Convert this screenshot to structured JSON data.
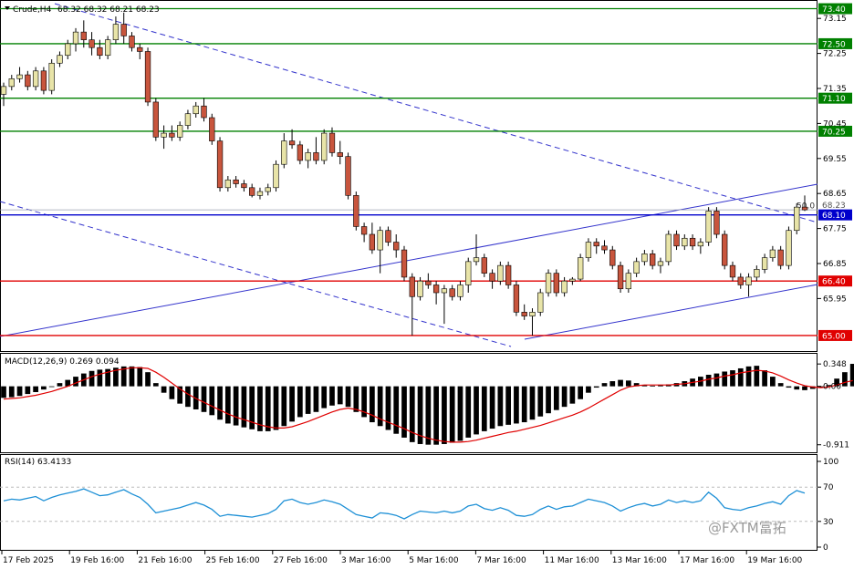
{
  "window": {
    "symbol_label": "Crude,H4",
    "ohlc_label": "68.32 68.32 68.21 68.23",
    "watermark": "@FXTM富拓"
  },
  "colors": {
    "bull": "#e8e4a8",
    "bear": "#c8553d",
    "wick": "#000000",
    "support": "#e00000",
    "resistance": "#008000",
    "pivot": "#0000cc",
    "macd_signal": "#e00000",
    "rsi_line": "#1e90d6"
  },
  "chart_data": [
    {
      "type": "candlestick",
      "name": "price",
      "ylim": [
        64.6,
        73.6
      ],
      "y_ticks": [
        "73.15",
        "72.25",
        "71.35",
        "70.45",
        "69.55",
        "68.65",
        "67.75",
        "66.85",
        "65.95"
      ],
      "x_tick_labels": [
        "17 Feb 2025",
        "19 Feb 16:00",
        "21 Feb 16:00",
        "25 Feb 16:00",
        "27 Feb 16:00",
        "3 Mar 16:00",
        "5 Mar 16:00",
        "7 Mar 16:00",
        "11 Mar 16:00",
        "13 Mar 16:00",
        "17 Mar 16:00",
        "19 Mar 16:00"
      ],
      "horizontal_levels": [
        {
          "label": "73.40",
          "value": 73.4,
          "kind": "resistance"
        },
        {
          "label": "72.50",
          "value": 72.5,
          "kind": "resistance"
        },
        {
          "label": "71.10",
          "value": 71.1,
          "kind": "resistance"
        },
        {
          "label": "70.25",
          "value": 70.25,
          "kind": "resistance"
        },
        {
          "label": "68.10",
          "value": 68.1,
          "kind": "pivot"
        },
        {
          "label": "66.40",
          "value": 66.4,
          "kind": "support"
        },
        {
          "label": "65.00",
          "value": 65.0,
          "kind": "support"
        }
      ],
      "current_price": {
        "label": "68.23",
        "value": 68.23
      },
      "fib_label": "50.0",
      "fib_value": 68.25,
      "candles": [
        [
          71.2,
          71.5,
          70.9,
          71.4
        ],
        [
          71.4,
          71.7,
          71.3,
          71.6
        ],
        [
          71.6,
          71.9,
          71.5,
          71.7
        ],
        [
          71.7,
          71.8,
          71.3,
          71.4
        ],
        [
          71.4,
          71.9,
          71.3,
          71.8
        ],
        [
          71.8,
          71.9,
          71.2,
          71.3
        ],
        [
          71.3,
          72.1,
          71.2,
          72.0
        ],
        [
          72.0,
          72.3,
          71.9,
          72.2
        ],
        [
          72.2,
          72.6,
          72.1,
          72.5
        ],
        [
          72.5,
          72.9,
          72.3,
          72.8
        ],
        [
          72.8,
          73.1,
          72.4,
          72.6
        ],
        [
          72.6,
          72.8,
          72.2,
          72.4
        ],
        [
          72.4,
          72.6,
          72.1,
          72.2
        ],
        [
          72.2,
          72.7,
          72.1,
          72.6
        ],
        [
          72.6,
          73.2,
          72.5,
          73.0
        ],
        [
          73.0,
          73.3,
          72.5,
          72.7
        ],
        [
          72.7,
          72.8,
          72.3,
          72.4
        ],
        [
          72.4,
          72.5,
          72.1,
          72.3
        ],
        [
          72.3,
          72.4,
          70.9,
          71.0
        ],
        [
          71.0,
          71.1,
          70.0,
          70.1
        ],
        [
          70.1,
          70.4,
          69.8,
          70.2
        ],
        [
          70.2,
          70.4,
          70.0,
          70.1
        ],
        [
          70.1,
          70.5,
          70.0,
          70.4
        ],
        [
          70.4,
          70.8,
          70.3,
          70.7
        ],
        [
          70.7,
          71.0,
          70.6,
          70.9
        ],
        [
          70.9,
          71.1,
          70.5,
          70.6
        ],
        [
          70.6,
          70.7,
          69.9,
          70.0
        ],
        [
          70.0,
          70.1,
          68.7,
          68.8
        ],
        [
          68.8,
          69.1,
          68.7,
          69.0
        ],
        [
          69.0,
          69.1,
          68.8,
          68.9
        ],
        [
          68.9,
          69.0,
          68.7,
          68.8
        ],
        [
          68.8,
          68.9,
          68.55,
          68.6
        ],
        [
          68.6,
          68.8,
          68.5,
          68.7
        ],
        [
          68.7,
          68.9,
          68.6,
          68.8
        ],
        [
          68.8,
          69.5,
          68.7,
          69.4
        ],
        [
          69.4,
          70.2,
          69.3,
          70.0
        ],
        [
          70.0,
          70.3,
          69.8,
          69.9
        ],
        [
          69.9,
          70.0,
          69.4,
          69.5
        ],
        [
          69.5,
          69.8,
          69.3,
          69.7
        ],
        [
          69.7,
          70.1,
          69.4,
          69.5
        ],
        [
          69.5,
          70.3,
          69.4,
          70.2
        ],
        [
          70.2,
          70.35,
          69.6,
          69.7
        ],
        [
          69.7,
          70.0,
          69.4,
          69.6
        ],
        [
          69.6,
          69.7,
          68.5,
          68.6
        ],
        [
          68.6,
          68.7,
          67.7,
          67.8
        ],
        [
          67.8,
          67.9,
          67.4,
          67.6
        ],
        [
          67.6,
          67.9,
          67.1,
          67.2
        ],
        [
          67.2,
          67.8,
          66.6,
          67.7
        ],
        [
          67.7,
          67.8,
          67.3,
          67.4
        ],
        [
          67.4,
          67.6,
          67.0,
          67.2
        ],
        [
          67.2,
          67.3,
          66.4,
          66.5
        ],
        [
          66.5,
          66.6,
          65.0,
          66.0
        ],
        [
          66.0,
          66.5,
          65.9,
          66.4
        ],
        [
          66.4,
          66.6,
          66.2,
          66.3
        ],
        [
          66.3,
          66.4,
          65.8,
          66.1
        ],
        [
          66.1,
          66.3,
          65.3,
          66.2
        ],
        [
          66.2,
          66.3,
          65.9,
          66.0
        ],
        [
          66.0,
          66.4,
          65.9,
          66.3
        ],
        [
          66.3,
          67.0,
          66.1,
          66.9
        ],
        [
          66.9,
          67.6,
          66.8,
          67.0
        ],
        [
          67.0,
          67.1,
          66.5,
          66.6
        ],
        [
          66.6,
          66.7,
          66.2,
          66.4
        ],
        [
          66.4,
          66.9,
          66.3,
          66.8
        ],
        [
          66.8,
          66.9,
          66.2,
          66.3
        ],
        [
          66.3,
          66.4,
          65.5,
          65.6
        ],
        [
          65.6,
          65.8,
          65.4,
          65.5
        ],
        [
          65.5,
          65.7,
          65.0,
          65.6
        ],
        [
          65.6,
          66.2,
          65.5,
          66.1
        ],
        [
          66.1,
          66.7,
          66.0,
          66.6
        ],
        [
          66.6,
          66.7,
          66.0,
          66.1
        ],
        [
          66.1,
          66.5,
          66.0,
          66.4
        ],
        [
          66.4,
          66.5,
          66.3,
          66.45
        ],
        [
          66.45,
          67.1,
          66.4,
          67.0
        ],
        [
          67.0,
          67.5,
          66.9,
          67.4
        ],
        [
          67.4,
          67.5,
          67.1,
          67.3
        ],
        [
          67.3,
          67.45,
          67.1,
          67.2
        ],
        [
          67.2,
          67.3,
          66.7,
          66.8
        ],
        [
          66.8,
          66.9,
          66.1,
          66.2
        ],
        [
          66.2,
          66.7,
          66.1,
          66.6
        ],
        [
          66.6,
          67.0,
          66.5,
          66.9
        ],
        [
          66.9,
          67.2,
          66.8,
          67.1
        ],
        [
          67.1,
          67.2,
          66.7,
          66.8
        ],
        [
          66.8,
          67.0,
          66.6,
          66.9
        ],
        [
          66.9,
          67.7,
          66.8,
          67.6
        ],
        [
          67.6,
          67.7,
          67.2,
          67.3
        ],
        [
          67.3,
          67.6,
          67.2,
          67.5
        ],
        [
          67.5,
          67.6,
          67.2,
          67.3
        ],
        [
          67.3,
          67.5,
          67.1,
          67.4
        ],
        [
          67.4,
          68.3,
          67.3,
          68.2
        ],
        [
          68.2,
          68.3,
          67.5,
          67.6
        ],
        [
          67.6,
          67.7,
          66.7,
          66.8
        ],
        [
          66.8,
          66.9,
          66.4,
          66.5
        ],
        [
          66.5,
          66.6,
          66.2,
          66.3
        ],
        [
          66.3,
          66.6,
          66.0,
          66.5
        ],
        [
          66.5,
          66.8,
          66.4,
          66.7
        ],
        [
          66.7,
          67.1,
          66.6,
          67.0
        ],
        [
          67.0,
          67.3,
          66.9,
          67.2
        ],
        [
          67.2,
          67.3,
          66.7,
          66.8
        ],
        [
          66.8,
          67.8,
          66.7,
          67.7
        ],
        [
          67.7,
          68.4,
          67.6,
          68.3
        ],
        [
          68.3,
          68.6,
          68.2,
          68.23
        ]
      ]
    },
    {
      "type": "bar",
      "name": "macd",
      "title": "MACD(12,26,9) 0.269 0.094",
      "ylim": [
        -1.0,
        0.45
      ],
      "y_ticks": [
        "0.348",
        "0.00",
        "-0.911"
      ],
      "histogram": [
        -0.18,
        -0.17,
        -0.15,
        -0.12,
        -0.09,
        -0.05,
        0.0,
        0.05,
        0.1,
        0.15,
        0.2,
        0.24,
        0.26,
        0.27,
        0.29,
        0.31,
        0.31,
        0.3,
        0.22,
        0.05,
        -0.1,
        -0.2,
        -0.27,
        -0.32,
        -0.36,
        -0.4,
        -0.45,
        -0.52,
        -0.58,
        -0.61,
        -0.64,
        -0.67,
        -0.7,
        -0.7,
        -0.68,
        -0.62,
        -0.55,
        -0.48,
        -0.43,
        -0.4,
        -0.34,
        -0.3,
        -0.28,
        -0.32,
        -0.4,
        -0.48,
        -0.56,
        -0.62,
        -0.68,
        -0.74,
        -0.8,
        -0.87,
        -0.9,
        -0.91,
        -0.91,
        -0.9,
        -0.88,
        -0.85,
        -0.8,
        -0.75,
        -0.7,
        -0.66,
        -0.62,
        -0.6,
        -0.58,
        -0.56,
        -0.52,
        -0.47,
        -0.42,
        -0.37,
        -0.32,
        -0.27,
        -0.2,
        -0.1,
        -0.02,
        0.05,
        0.08,
        0.1,
        0.09,
        0.05,
        0.02,
        0.01,
        0.02,
        0.03,
        0.05,
        0.08,
        0.12,
        0.15,
        0.18,
        0.2,
        0.23,
        0.25,
        0.28,
        0.31,
        0.32,
        0.25,
        0.15,
        0.05,
        -0.02,
        -0.05,
        -0.06,
        -0.04,
        -0.02,
        0.02,
        0.12,
        0.22,
        0.35
      ],
      "signal": [
        -0.2,
        -0.19,
        -0.18,
        -0.16,
        -0.14,
        -0.11,
        -0.08,
        -0.04,
        0.0,
        0.05,
        0.1,
        0.15,
        0.19,
        0.22,
        0.25,
        0.27,
        0.29,
        0.29,
        0.28,
        0.22,
        0.14,
        0.05,
        -0.04,
        -0.12,
        -0.19,
        -0.25,
        -0.31,
        -0.37,
        -0.43,
        -0.48,
        -0.52,
        -0.56,
        -0.6,
        -0.63,
        -0.65,
        -0.65,
        -0.63,
        -0.59,
        -0.55,
        -0.5,
        -0.45,
        -0.4,
        -0.36,
        -0.34,
        -0.36,
        -0.4,
        -0.45,
        -0.51,
        -0.56,
        -0.61,
        -0.66,
        -0.72,
        -0.77,
        -0.81,
        -0.84,
        -0.86,
        -0.87,
        -0.87,
        -0.86,
        -0.84,
        -0.81,
        -0.78,
        -0.75,
        -0.72,
        -0.7,
        -0.67,
        -0.64,
        -0.61,
        -0.57,
        -0.53,
        -0.49,
        -0.45,
        -0.4,
        -0.34,
        -0.27,
        -0.2,
        -0.13,
        -0.06,
        -0.01,
        0.01,
        0.02,
        0.02,
        0.02,
        0.02,
        0.03,
        0.04,
        0.06,
        0.08,
        0.11,
        0.13,
        0.16,
        0.18,
        0.21,
        0.23,
        0.25,
        0.24,
        0.21,
        0.16,
        0.1,
        0.05,
        0.01,
        -0.01,
        -0.02,
        -0.01,
        0.02,
        0.06,
        0.09
      ]
    },
    {
      "type": "line",
      "name": "rsi",
      "title": "RSI(14) 63.4133",
      "ylim": [
        0,
        100
      ],
      "y_ticks": [
        "100",
        "70",
        "30",
        "0"
      ],
      "levels": [
        70,
        30
      ],
      "values": [
        54,
        56,
        55,
        57,
        59,
        54,
        58,
        61,
        63,
        65,
        68,
        64,
        60,
        61,
        64,
        67,
        62,
        58,
        50,
        40,
        42,
        44,
        46,
        49,
        52,
        49,
        44,
        36,
        38,
        37,
        36,
        35,
        37,
        39,
        44,
        54,
        56,
        52,
        50,
        52,
        55,
        53,
        50,
        44,
        38,
        36,
        34,
        40,
        39,
        37,
        33,
        38,
        42,
        41,
        40,
        42,
        40,
        42,
        48,
        50,
        45,
        43,
        46,
        43,
        37,
        36,
        38,
        44,
        48,
        44,
        47,
        48,
        52,
        56,
        54,
        52,
        48,
        42,
        46,
        49,
        51,
        48,
        50,
        55,
        52,
        54,
        52,
        54,
        64,
        57,
        46,
        44,
        43,
        46,
        48,
        51,
        53,
        50,
        60,
        66,
        63
      ]
    }
  ]
}
